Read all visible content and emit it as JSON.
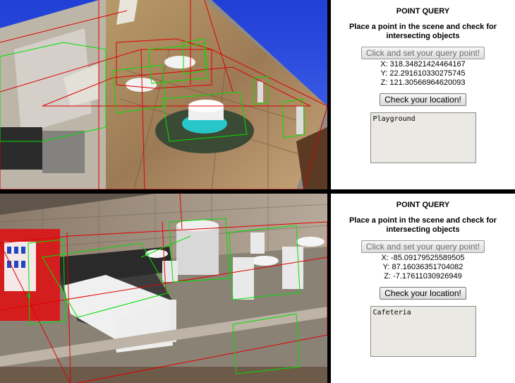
{
  "panels": [
    {
      "title": "POINT QUERY",
      "instructions": "Place a point in the scene and check for intersecting objects",
      "set_point_label": "Click and set your query point!",
      "x": "X: 318.34821424464167",
      "y": "Y: 22.291610330275745",
      "z": "Z: 121.30566964620093",
      "check_label": "Check your location!",
      "result_text": "Playground"
    },
    {
      "title": "POINT QUERY",
      "instructions": "Place a point in the scene and check for intersecting objects",
      "set_point_label": "Click and set your query point!",
      "x": "X: -85.09179525589505",
      "y": "Y: 87.16036351704082",
      "z": "Z: -7.17611030926949",
      "check_label": "Check your location!",
      "result_text": "Cafeteria"
    }
  ],
  "colors": {
    "bounding_box_red": "#e00000",
    "bounding_box_green": "#00e000",
    "sky": "#2b47d8"
  }
}
